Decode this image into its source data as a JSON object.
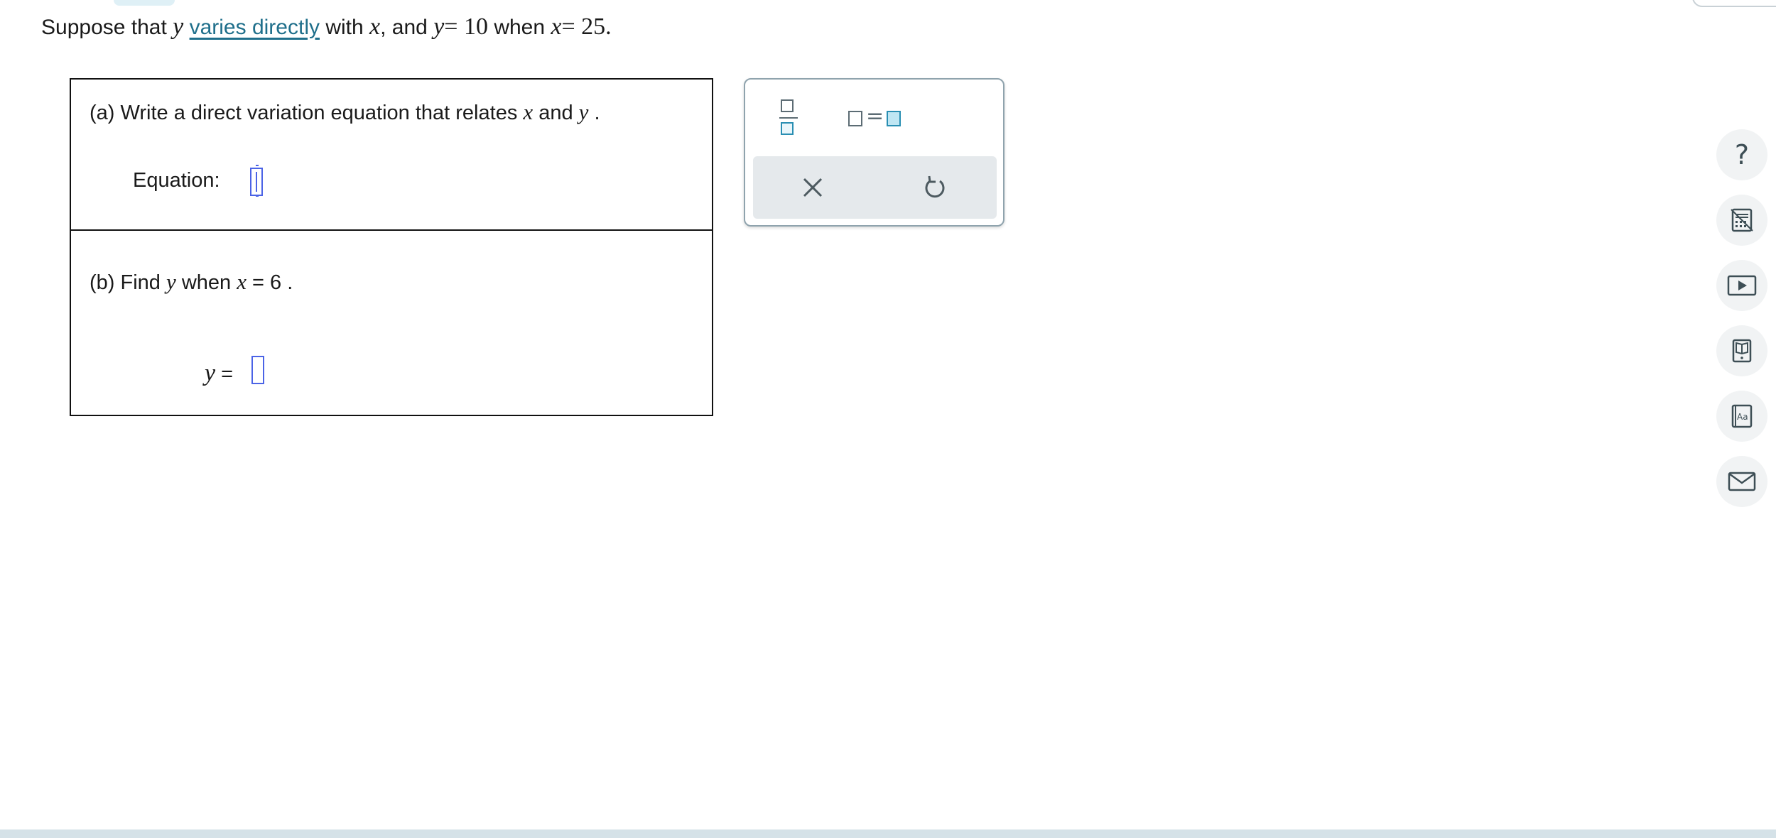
{
  "problem": {
    "intro": "Suppose that",
    "var_y": "y",
    "link_text": "varies directly",
    "with_text": "with",
    "var_x": "x",
    "comma_and": ", and",
    "eq1": "= 10",
    "when_text": "when",
    "eq2": "= 25."
  },
  "part_a": {
    "label": "(a) Write a direct variation equation that relates",
    "var_x": "x",
    "and_text": "and",
    "var_y": "y",
    "period": ".",
    "equation_label": "Equation:"
  },
  "part_b": {
    "label": "(b) Find",
    "var_y": "y",
    "when_text": "when",
    "var_x": "x",
    "condition": "= 6",
    "period": ".",
    "answer_var": "y",
    "answer_eq": "="
  },
  "toolbar": {
    "equals_symbol": "="
  },
  "sidebar": {
    "help_symbol": "?"
  },
  "colors": {
    "link": "#1f6f8b",
    "input_border": "#4b63e6",
    "icon": "#3d4e55",
    "accent_fill": "#bfe6f3"
  }
}
